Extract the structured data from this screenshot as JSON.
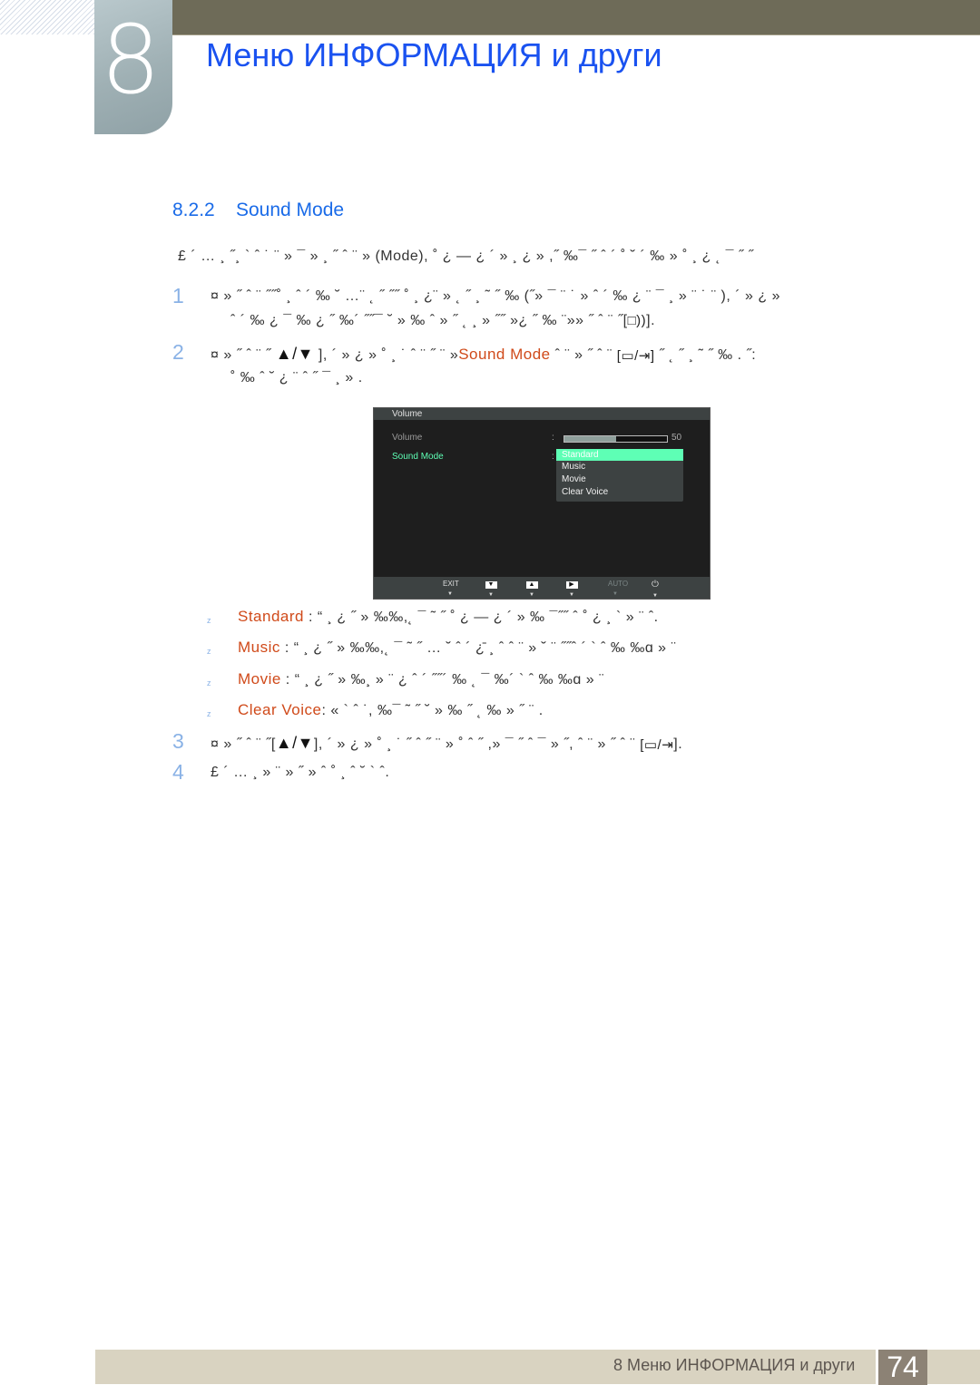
{
  "header": {
    "chapter_number": "8",
    "chapter_title": "Меню ИНФОРМАЦИЯ и други"
  },
  "section": {
    "number": "8.2.2",
    "title": "Sound Mode"
  },
  "intro": {
    "text_a": "£ ´ …   ¸  ˝¸     ` ˆ ˙  ¨ » ¯ »  ¸ ˝ ˆ ¨ »",
    "mode_word": "(Mode),",
    "text_b": "˚   ¿ —   ¿ ´ »    ¸   ¿ » ,˝ ‰¯      ˝          ˆ ´ ˚    ˘ ´ ‰ »   ˚  ¸    ¿ ˛ ¯ ˝   ˝"
  },
  "steps": [
    {
      "number": "1",
      "line1": "¤ » ˝ ˆ   ¨    ˝˝˚  ¸    ˆ ´ ‰    ˘  …¨ ˛   ˝    ˝˝ ˚  ¸   ¿¨ » ˛    ˝  ¸   ˜    ˝ ‰  (˝» ¯   ¨    ˙ » ˆ ´ ‰    ¿    ¨ ¯  ¸ » ¨    ˙    ¨    ),  ´ » ¿ »",
      "line2": "ˆ ´ ‰    ¿    ¯    ‰    ¿    ˝ ‰´  ˝˝¯ ˘  » ‰ ˆ  »  ˝  ˛ ¸ » ˝˝ »¿ ˝    ‰ ¨»» ˝ ˆ    ¨   ˝[",
      "icon": "speaker-icon",
      "line2_end": "]."
    },
    {
      "number": "2",
      "line1_a": "¤ » ˝ ˆ   ¨    ˝",
      "keys": "▲/▼",
      "line1_b": "],  ´ » ¿ » ˚  ¸      ˙ ˆ ¨     ˝    ¨ »",
      "highlight": "Sound Mode",
      "line1_c": "  ˆ  ¨  » ˝ ˆ    ¨",
      "line1_end": "˝   ˛    ˝  ¸    ˜    ˝ ‰ .  ˝:",
      "line2": "˚     ‰ ˆ ˘    ¿ ¨ ˆ     ˝ ¯   ¸ » ."
    },
    {
      "number": "3",
      "line1_a": "¤ » ˝ ˆ   ¨    ˝[",
      "keys": "▲/▼",
      "line1_b": "],  ´ » ¿ »      ˚  ¸     ˙        ˝ ˆ ˝  ¨ »     ˚    ˆ     ˝ ,» ¯        ˝    ˆ    ¯  » ˝,  ˆ  ¨  » ˝ ˆ    ¨",
      "line1_end": "]."
    },
    {
      "number": "4",
      "line1": "£ ´ …  ¸ » ¨  » ˝ » ˆ                  ˚  ¸ ˆ ˘     ` ˆ."
    }
  ],
  "osd": {
    "header": "Volume",
    "volume_label": "Volume",
    "volume_colon": ":",
    "volume_value": "50",
    "volume_fraction": 0.5,
    "sound_mode_label": "Sound Mode",
    "sound_mode_colon": ":",
    "options": [
      "Standard",
      "Music",
      "Movie",
      "Clear Voice"
    ],
    "selected_option": "Standard",
    "footer_buttons": [
      "EXIT",
      "▼",
      "▲",
      "▶",
      "AUTO",
      "⏻"
    ]
  },
  "mode_descriptions": [
    {
      "name": "Standard",
      "text": " :  “ ¸   ¿      ˝ » ‰‰,˛  ¯    ˜ ˝         ˚    ¿ —    ¿  ´ » ‰       ¯˝˝ ˆ ˚          ¿     ¸  ` » ¨ ˆ."
    },
    {
      "name": "Music",
      "text": " :  “ ¸   ¿      ˝ » ‰‰,˛  ¯    ˜ ˝         … ˘ ˆ ´    ¿̄      ¸ ˆ    ˆ ¨ » ˘ ¨    ˝˝ˆ ´ ` ˆ ‰    ‰ɑ » ¨"
    },
    {
      "name": "Movie",
      "text": " :  “ ¸   ¿      ˝ » ‰¸ » ¨  ¿ ˆ     ´ ˝˝´ ‰  ˛  ¯    ‰´ ` ˆ ‰    ‰ɑ » ¨"
    },
    {
      "name": "Clear Voice",
      "text": ":  «    ` ˆ ˙,  ‰¯    ˜ ˝        ˘ »      ‰     ˝        ˛ ‰ » ˝ ¨  ."
    }
  ],
  "bullet_glyph": "z",
  "footer": {
    "text": "8 Меню ИНФОРМАЦИЯ и други",
    "page_number": "74"
  },
  "colors": {
    "title_blue": "#1a52f0",
    "section_blue": "#1a6be8",
    "highlight_orange": "#d04a1a",
    "osd_green": "#5effb5",
    "top_bar": "#6e6b58",
    "footer_band": "#d9d3c1",
    "page_box": "#8c8275"
  }
}
